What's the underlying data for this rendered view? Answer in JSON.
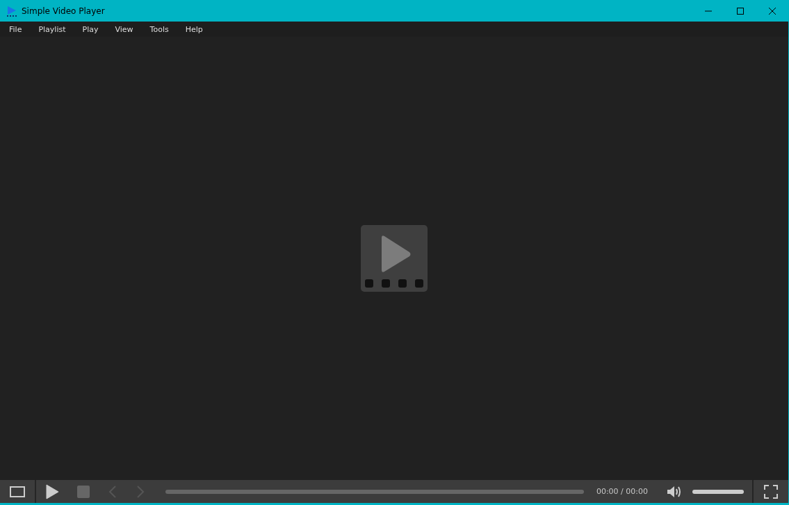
{
  "window": {
    "title": "Simple Video Player"
  },
  "menu": [
    "File",
    "Playlist",
    "Play",
    "View",
    "Tools",
    "Help"
  ],
  "controls": {
    "seek": {
      "level": 0
    },
    "time": "00:00 / 00:00",
    "volume": {
      "level": 1
    }
  }
}
